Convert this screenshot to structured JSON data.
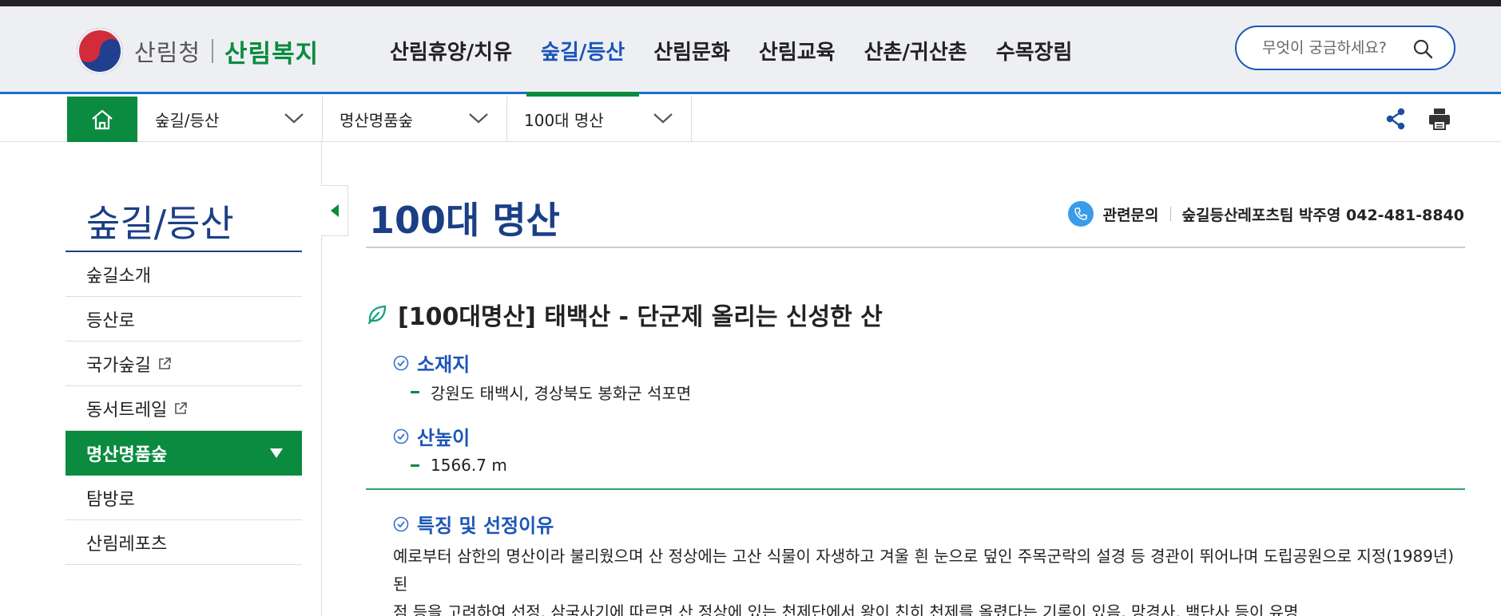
{
  "header": {
    "org_name": "산림청",
    "brand_name": "산림복지",
    "gnb": [
      {
        "label": "산림휴양/치유"
      },
      {
        "label": "숲길/등산"
      },
      {
        "label": "산림문화"
      },
      {
        "label": "산림교육"
      },
      {
        "label": "산촌/귀산촌"
      },
      {
        "label": "수목장림"
      }
    ],
    "active_gnb": "숲길/등산",
    "search": {
      "placeholder": "무엇이 궁금하세요?"
    }
  },
  "breadcrumb": {
    "items": [
      {
        "label": "숲길/등산"
      },
      {
        "label": "명산명품숲"
      },
      {
        "label": "100대 명산"
      }
    ]
  },
  "sidebar": {
    "title": "숲길/등산",
    "items": [
      {
        "label": "숲길소개"
      },
      {
        "label": "등산로"
      },
      {
        "label": "국가숲길"
      },
      {
        "label": "동서트레일"
      },
      {
        "label": "명산명품숲"
      },
      {
        "label": "탐방로"
      },
      {
        "label": "산림레포츠"
      }
    ],
    "active_item": "명산명품숲"
  },
  "main": {
    "page_title": "100대 명산",
    "contact": {
      "label": "관련문의",
      "value": "숲길등산레포츠팀 박주영 042-481-8840"
    },
    "section_title": "[100대명산] 태백산 - 단군제 올리는 신성한 산",
    "location": {
      "heading": "소재지",
      "value": "강원도 태백시, 경상북도 봉화군 석포면"
    },
    "height": {
      "heading": "산높이",
      "value": "1566.7 m"
    },
    "features": {
      "heading": "특징 및 선정이유",
      "line1": "예로부터 삼한의 명산이라 불리웠으며 산 정상에는 고산 식물이 자생하고 겨울 흰 눈으로 덮인 주목군락의 설경 등 경관이 뛰어나며 도립공원으로 지정(1989년)된",
      "line2": "점 등을 고려하여 선정, 삼국사기에 따르면 산 정상에 있는 천제단에서 왕이 친히 천제를 올렸다는 기록이 있음. 망경사, 백단사 등이 유명"
    }
  },
  "colors": {
    "brand_green": "#0a8b3f",
    "primary_blue": "#1b56b7",
    "title_navy": "#1b3f86",
    "header_bg": "#eeeff3"
  },
  "icons": [
    "home-icon",
    "chevron-down-icon",
    "share-icon",
    "print-icon",
    "search-icon",
    "external-link-icon",
    "phone-icon",
    "leaf-icon",
    "check-circle-icon"
  ]
}
